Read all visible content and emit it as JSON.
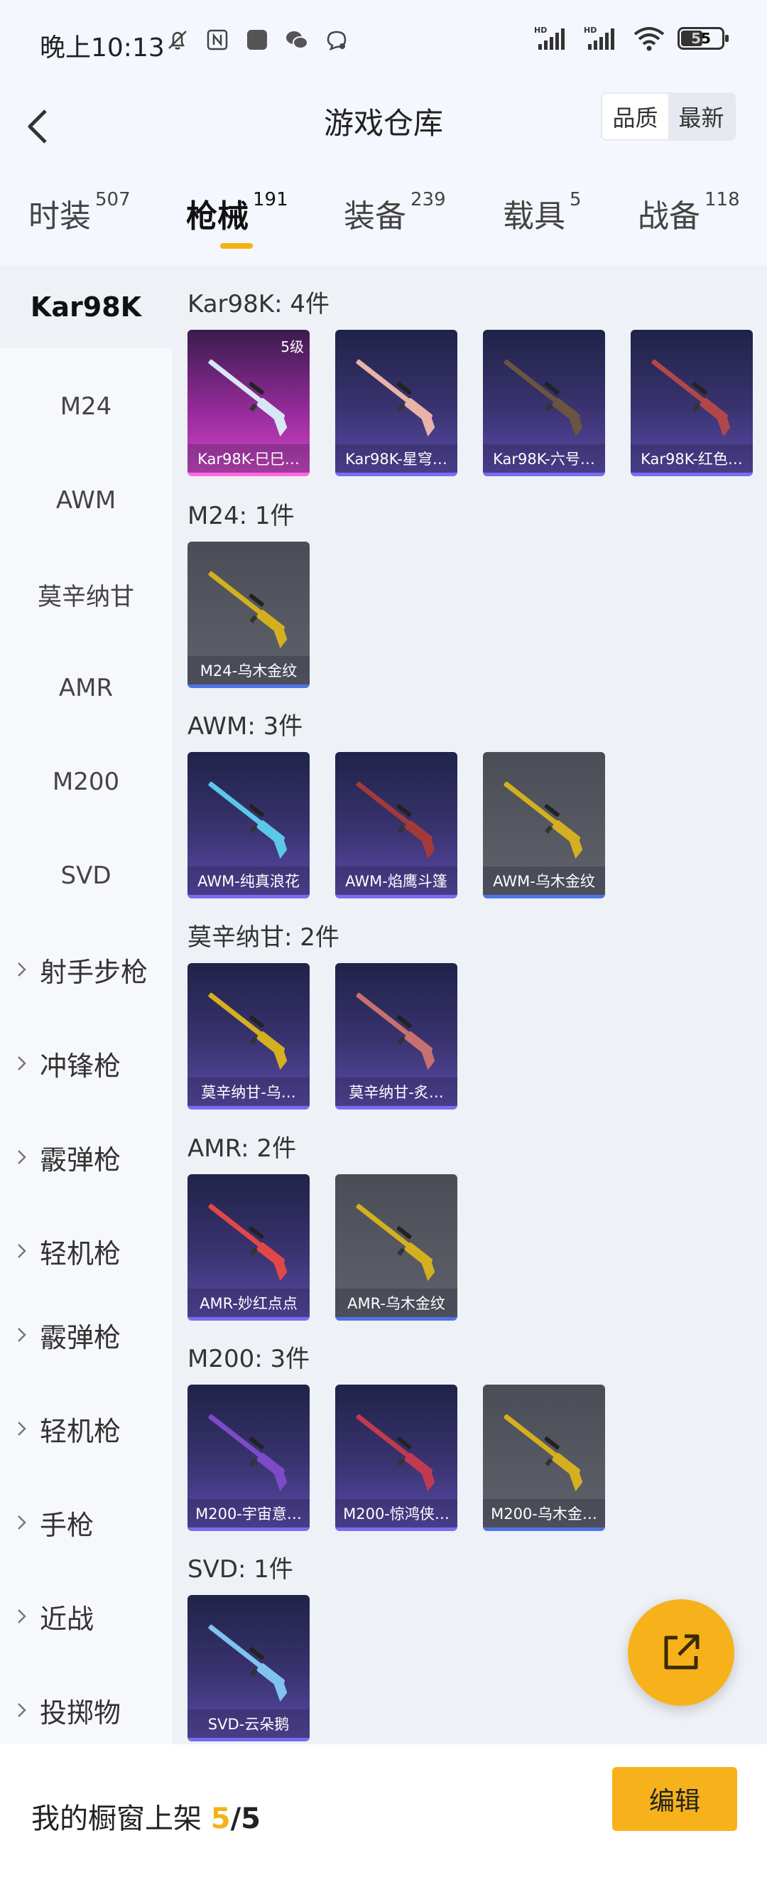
{
  "status_bar": {
    "time": "晚上10:13",
    "battery": "55",
    "network_badges": [
      "HD",
      "HD"
    ]
  },
  "header": {
    "title": "游戏仓库",
    "sort_options": [
      "品质",
      "最新"
    ],
    "sort_selected": "品质"
  },
  "tabs": [
    {
      "label": "时装",
      "count": "507"
    },
    {
      "label": "枪械",
      "count": "191"
    },
    {
      "label": "装备",
      "count": "239"
    },
    {
      "label": "载具",
      "count": "5"
    },
    {
      "label": "战备",
      "count": "118"
    }
  ],
  "active_tab": "枪械",
  "sidebar": {
    "items": [
      {
        "label": "Kar98K",
        "active": true,
        "group": false
      },
      {
        "label": "M24",
        "active": false,
        "group": false
      },
      {
        "label": "AWM",
        "active": false,
        "group": false
      },
      {
        "label": "莫辛纳甘",
        "active": false,
        "group": false
      },
      {
        "label": "AMR",
        "active": false,
        "group": false
      },
      {
        "label": "M200",
        "active": false,
        "group": false
      },
      {
        "label": "SVD",
        "active": false,
        "group": false
      },
      {
        "label": "射手步枪",
        "active": false,
        "group": true
      },
      {
        "label": "冲锋枪",
        "active": false,
        "group": true
      },
      {
        "label": "霰弹枪",
        "active": false,
        "group": true
      },
      {
        "label": "轻机枪",
        "active": false,
        "group": true
      },
      {
        "label": "霰弹枪",
        "active": false,
        "group": true
      },
      {
        "label": "轻机枪",
        "active": false,
        "group": true
      },
      {
        "label": "手枪",
        "active": false,
        "group": true
      },
      {
        "label": "近战",
        "active": false,
        "group": true
      },
      {
        "label": "投掷物",
        "active": false,
        "group": true
      }
    ]
  },
  "sections": [
    {
      "title": "Kar98K: 4件",
      "items": [
        {
          "label": "Kar98K-巳巳…",
          "rarity": "pink",
          "level": "5级",
          "gun_color": "#d8e6f5"
        },
        {
          "label": "Kar98K-星穹…",
          "rarity": "purple",
          "level": "",
          "gun_color": "#e8b3a8"
        },
        {
          "label": "Kar98K-六号…",
          "rarity": "purple",
          "level": "",
          "gun_color": "#6b5440"
        },
        {
          "label": "Kar98K-红色…",
          "rarity": "purple",
          "level": "",
          "gun_color": "#b0484a"
        }
      ]
    },
    {
      "title": "M24: 1件",
      "items": [
        {
          "label": "M24-乌木金纹",
          "rarity": "gray",
          "level": "",
          "gun_color": "#d4b020"
        }
      ]
    },
    {
      "title": "AWM: 3件",
      "items": [
        {
          "label": "AWM-纯真浪花",
          "rarity": "purple",
          "level": "",
          "gun_color": "#5cc8e8"
        },
        {
          "label": "AWM-焰鹰斗篷",
          "rarity": "purple",
          "level": "",
          "gun_color": "#a33a3a"
        },
        {
          "label": "AWM-乌木金纹",
          "rarity": "gray",
          "level": "",
          "gun_color": "#d4b020"
        }
      ]
    },
    {
      "title": "莫辛纳甘: 2件",
      "items": [
        {
          "label": "莫辛纳甘-乌…",
          "rarity": "purple",
          "level": "",
          "gun_color": "#d4b020"
        },
        {
          "label": "莫辛纳甘-炙…",
          "rarity": "purple",
          "level": "",
          "gun_color": "#c87070"
        }
      ]
    },
    {
      "title": "AMR: 2件",
      "items": [
        {
          "label": "AMR-妙红点点",
          "rarity": "purple",
          "level": "",
          "gun_color": "#e04848"
        },
        {
          "label": "AMR-乌木金纹",
          "rarity": "gray",
          "level": "",
          "gun_color": "#d4b020"
        }
      ]
    },
    {
      "title": "M200: 3件",
      "items": [
        {
          "label": "M200-宇宙意…",
          "rarity": "purple",
          "level": "",
          "gun_color": "#7d4ac8"
        },
        {
          "label": "M200-惊鸿侠…",
          "rarity": "purple",
          "level": "",
          "gun_color": "#c03a50"
        },
        {
          "label": "M200-乌木金…",
          "rarity": "gray",
          "level": "",
          "gun_color": "#d4b020"
        }
      ]
    },
    {
      "title": "SVD: 1件",
      "items": [
        {
          "label": "SVD-云朵鹅",
          "rarity": "purple",
          "level": "",
          "gun_color": "#7fc4ee"
        }
      ]
    }
  ],
  "fab": {
    "icon": "share-external-icon"
  },
  "bottom_bar": {
    "text": "我的橱窗上架",
    "current": "5",
    "total": "5",
    "edit_label": "编辑"
  }
}
